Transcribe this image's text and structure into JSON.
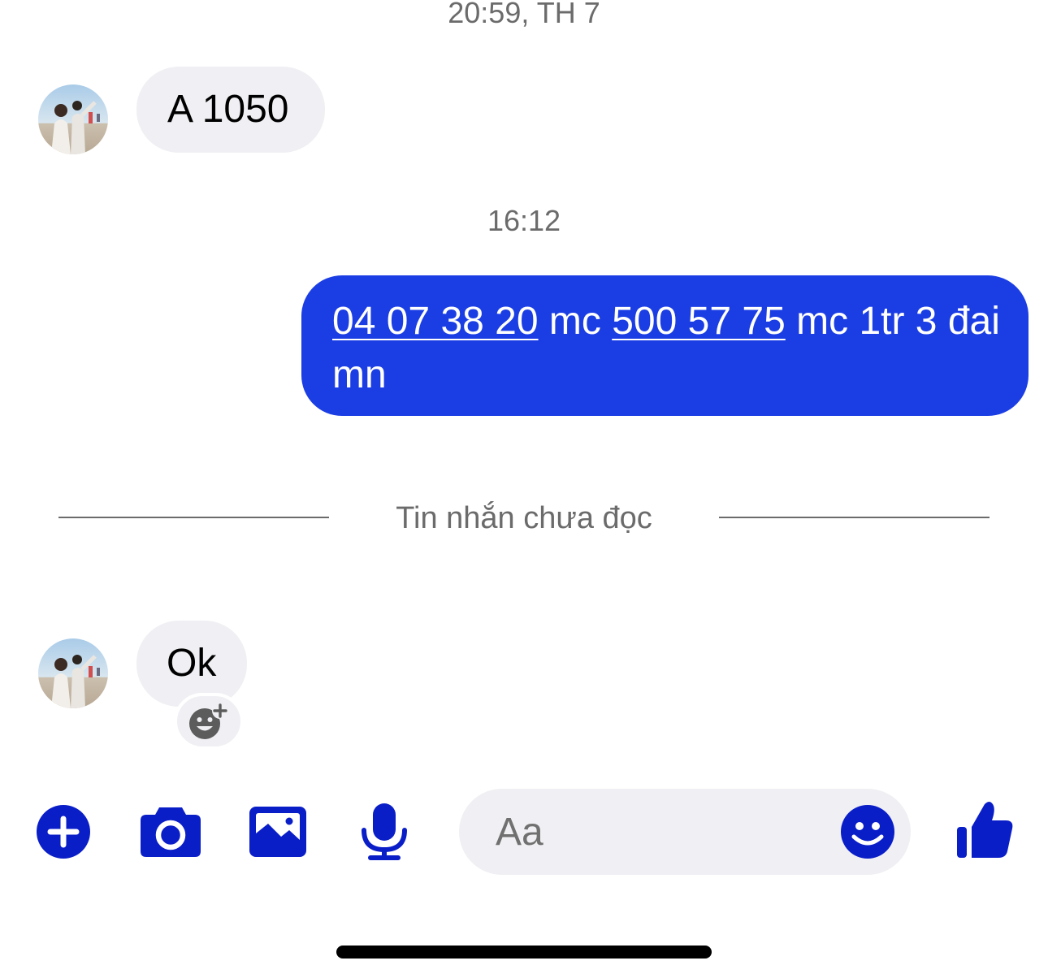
{
  "timestamps": {
    "first": "20:59, TH 7",
    "second": "16:12"
  },
  "messages": {
    "incoming_1": {
      "text": "A 1050"
    },
    "outgoing_1": {
      "link_1": "04 07 38 20",
      "text_1": " mc ",
      "link_2": "500 57 75",
      "text_2": " mc 1tr 3 đai mn"
    },
    "incoming_2": {
      "text": "Ok"
    }
  },
  "divider": {
    "label": "Tin nhắn chưa đọc"
  },
  "composer": {
    "placeholder": "Aa"
  },
  "icons": {
    "plus": "plus-circle-icon",
    "camera": "camera-icon",
    "image": "image-icon",
    "mic": "microphone-icon",
    "emoji": "smiley-icon",
    "like": "thumbs-up-icon",
    "react": "add-reaction-icon"
  },
  "colors": {
    "accent": "#1b3ee4",
    "icon_blue": "#0a1ec8",
    "incoming_bubble": "#f0f0f4",
    "timestamp_text": "#6b6b6b"
  }
}
